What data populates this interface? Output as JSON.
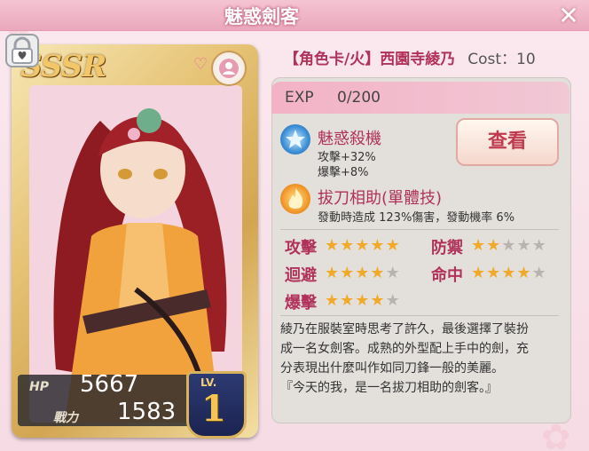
{
  "window": {
    "title": "魅惑劍客",
    "close_icon": "close-icon"
  },
  "card": {
    "rarity": "SSSR",
    "hp_label": "HP",
    "hp": "5667",
    "power_label": "戰力",
    "power": "1583",
    "level_label": "LV.",
    "level": "1",
    "lock_icon": "lock-heart-icon",
    "profile_icon": "profile-icon"
  },
  "header": {
    "category": "【角色卡/火】西園寺綾乃",
    "cost": "Cost：10"
  },
  "exp": {
    "label": "EXP",
    "value": "0/200"
  },
  "skills": [
    {
      "name": "魅惑殺機",
      "desc1": "攻擊+32%",
      "desc2": "爆擊+8%",
      "icon": "blue-star-icon"
    },
    {
      "name": "拔刀相助(單體技)",
      "desc1": "發動時造成 123%傷害，發動機率 6%",
      "icon": "flame-icon"
    }
  ],
  "view_button": "查看",
  "stats": [
    {
      "label": "攻擊",
      "stars": 5
    },
    {
      "label": "防禦",
      "stars": 2
    },
    {
      "label": "迴避",
      "stars": 4
    },
    {
      "label": "命中",
      "stars": 4
    },
    {
      "label": "爆擊",
      "stars": 4
    }
  ],
  "description": [
    "綾乃在服裝室時思考了許久，最後選擇了裝扮",
    "成一名女劍客。成熟的外型配上手中的劍，充",
    "分表現出什麼叫作如同刀鋒一般的美麗。",
    "『今天的我，是一名拔刀相助的劍客。』"
  ],
  "colors": {
    "accent": "#b0325b",
    "star_on": "#f1a92a",
    "star_off": "#b9b3ae"
  }
}
